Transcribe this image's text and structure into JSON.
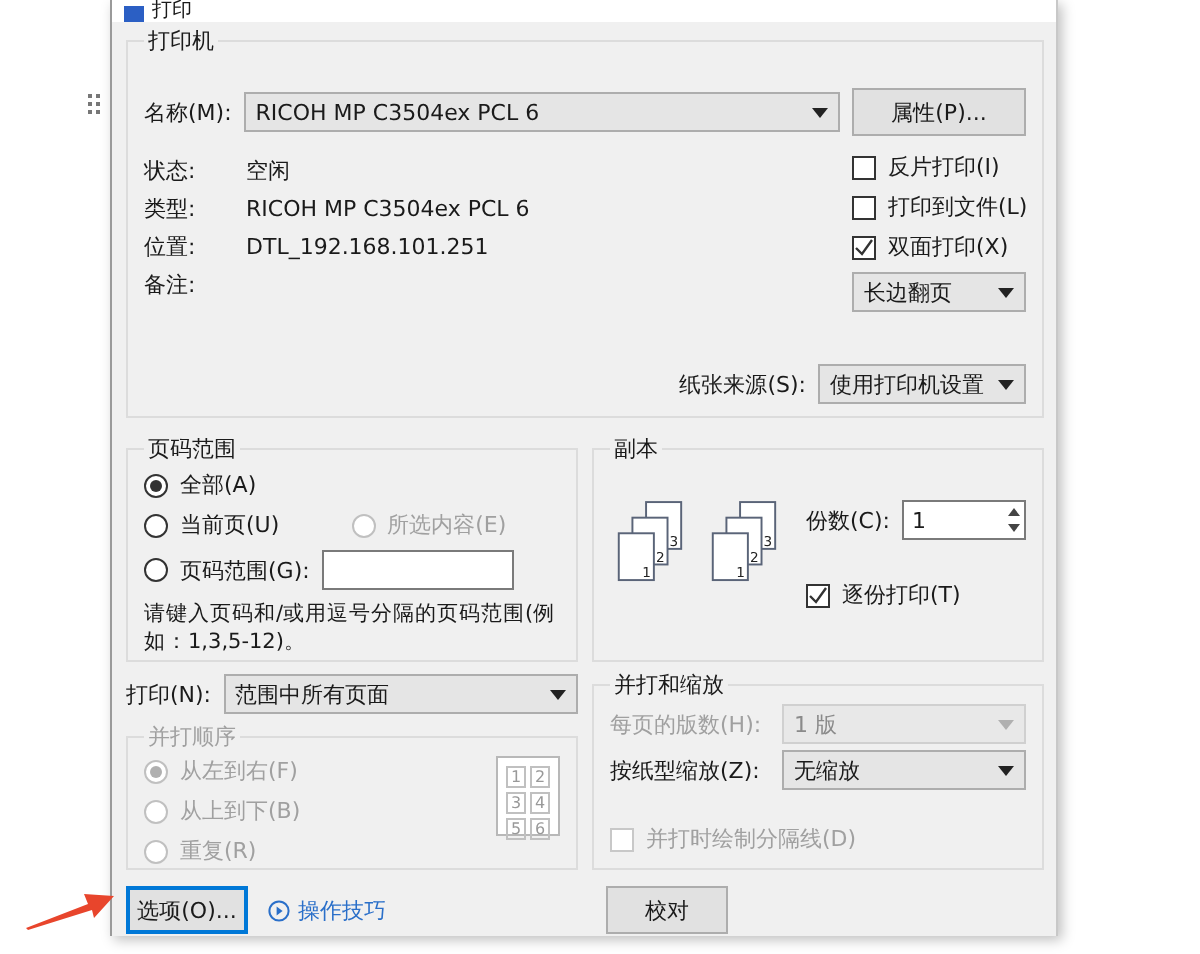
{
  "window": {
    "title": "打印"
  },
  "printer": {
    "label": "打印机",
    "name_label": "名称(M):",
    "name_value": "RICOH MP C3504ex PCL 6",
    "properties_button": "属性(P)...",
    "info": [
      {
        "label": "状态:",
        "value": "空闲"
      },
      {
        "label": "类型:",
        "value": "RICOH MP C3504ex PCL 6"
      },
      {
        "label": "位置:",
        "value": "DTL_192.168.101.251"
      },
      {
        "label": "备注:"
      }
    ],
    "options": [
      {
        "label": "反片打印(I)",
        "checked": false
      },
      {
        "label": "打印到文件(L)",
        "checked": false
      },
      {
        "label": "双面打印(X)",
        "checked": true
      }
    ],
    "duplex_value": "长边翻页",
    "paper_source_label": "纸张来源(S):",
    "paper_source_value": "使用打印机设置"
  },
  "page_range": {
    "label": "页码范围",
    "options": [
      {
        "label": "全部(A)",
        "selected": true,
        "disabled": false
      },
      {
        "label": "当前页(U)",
        "selected": false,
        "disabled": false
      },
      {
        "label": "所选内容(E)",
        "selected": false,
        "disabled": true
      },
      {
        "label": "页码范围(G):",
        "selected": false,
        "disabled": false
      }
    ],
    "hint": "请键入页码和/或用逗号分隔的页码范围(例如：1,3,5-12)。"
  },
  "copies": {
    "label": "副本",
    "stacks": [
      [
        "3",
        "2",
        "1"
      ],
      [
        "3",
        "2",
        "1"
      ]
    ],
    "count_label": "份数(C):",
    "count_value": "1",
    "collate": {
      "label": "逐份打印(T)",
      "checked": true
    }
  },
  "print_what": {
    "label": "打印(N):",
    "value": "范围中所有页面"
  },
  "order": {
    "label": "并打顺序",
    "disabled": true,
    "options": [
      {
        "label": "从左到右(F)",
        "selected": true
      },
      {
        "label": "从上到下(B)",
        "selected": false
      },
      {
        "label": "重复(R)",
        "selected": false
      }
    ],
    "cells": [
      "1",
      "2",
      "3",
      "4",
      "5",
      "6"
    ]
  },
  "zoom": {
    "label": "并打和缩放",
    "fields": [
      {
        "label": "每页的版数(H):",
        "value": "1 版",
        "disabled": true
      },
      {
        "label": "按纸型缩放(Z):",
        "value": "无缩放",
        "disabled": false
      }
    ],
    "separator": {
      "label": "并打时绘制分隔线(D)",
      "checked": false,
      "disabled": true
    }
  },
  "buttons": [
    {
      "kind": "button",
      "label": "选项(O)...",
      "focused": true
    },
    {
      "kind": "link",
      "label": "操作技巧"
    },
    {
      "kind": "button",
      "label": "校对",
      "focused": false
    }
  ],
  "annotation_arrow": true
}
